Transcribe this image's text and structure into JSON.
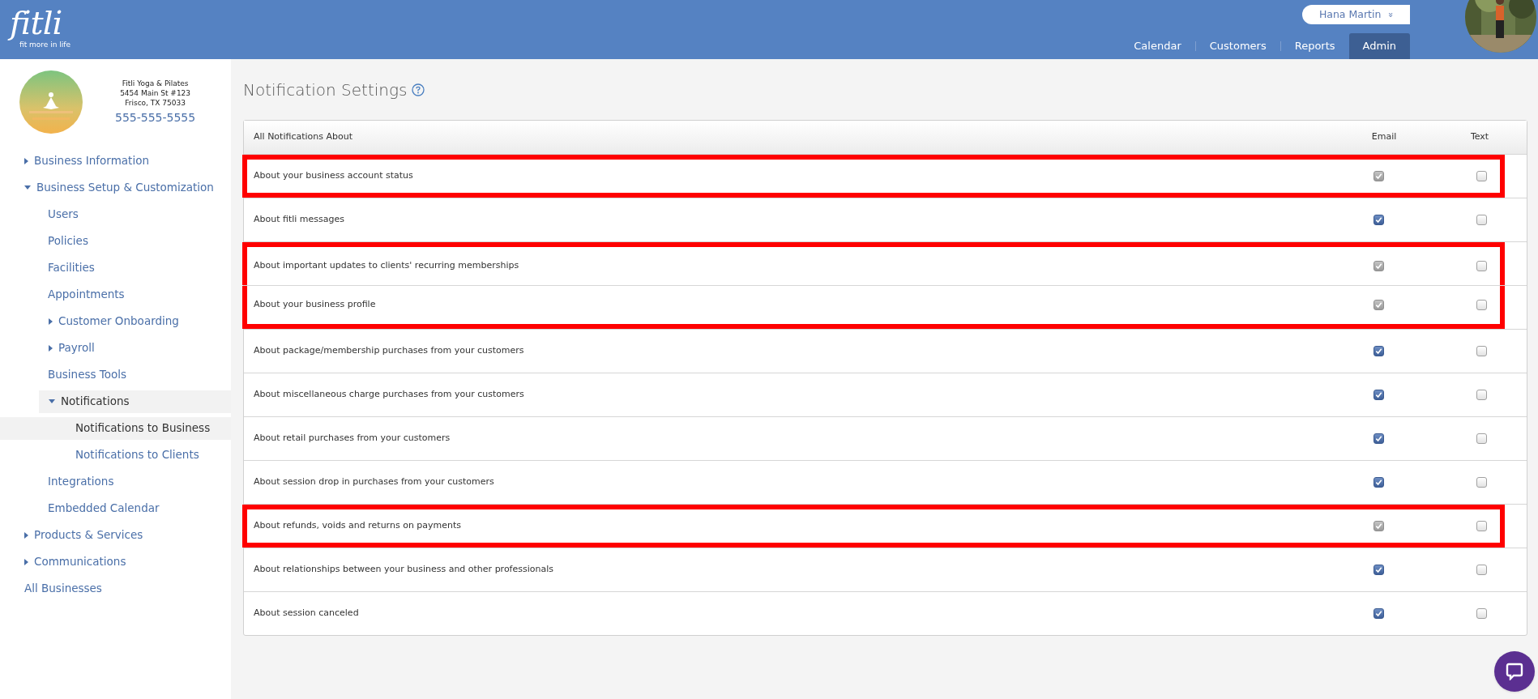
{
  "header": {
    "logo": {
      "word": "fitli",
      "tagline": "fit more in life"
    },
    "user": {
      "name": "Hana Martin",
      "menu_icon": "»"
    },
    "nav": [
      {
        "label": "Calendar",
        "selected": false
      },
      {
        "label": "Customers",
        "selected": false
      },
      {
        "label": "Reports",
        "selected": false
      },
      {
        "label": "Admin",
        "selected": true
      }
    ]
  },
  "business": {
    "name": "Fitli Yoga & Pilates",
    "address_line_1": "5454 Main St #123",
    "address_line_2": "Frisco, TX 75033",
    "phone": "555-555-5555"
  },
  "sidebar": {
    "items": [
      {
        "label": "Business Information",
        "expanded": false,
        "selected": false
      },
      {
        "label": "Business Setup & Customization",
        "expanded": true,
        "selected": false,
        "children": [
          {
            "label": "Users",
            "selected": false
          },
          {
            "label": "Policies",
            "selected": false
          },
          {
            "label": "Facilities",
            "selected": false
          },
          {
            "label": "Appointments",
            "selected": false
          },
          {
            "label": "Customer Onboarding",
            "expanded": false,
            "selected": false
          },
          {
            "label": "Payroll",
            "expanded": false,
            "selected": false
          },
          {
            "label": "Business Tools",
            "selected": false
          },
          {
            "label": "Notifications",
            "expanded": true,
            "selected": true,
            "children": [
              {
                "label": "Notifications to Business",
                "selected": true
              },
              {
                "label": "Notifications to Clients",
                "selected": false
              }
            ]
          },
          {
            "label": "Integrations",
            "selected": false
          },
          {
            "label": "Embedded Calendar",
            "selected": false
          }
        ]
      },
      {
        "label": "Products & Services",
        "expanded": false,
        "selected": false
      },
      {
        "label": "Communications",
        "expanded": false,
        "selected": false
      },
      {
        "label": "All Businesses",
        "selected": false
      }
    ]
  },
  "page_title": "Notification Settings",
  "table": {
    "columns": [
      "All Notifications About",
      "Email",
      "Text"
    ],
    "rows": [
      {
        "label": "About your business account status",
        "email_checked": true,
        "email_disabled": true,
        "text_checked": false,
        "highlighted": true
      },
      {
        "label": "About fitli messages",
        "email_checked": true,
        "email_disabled": false,
        "text_checked": false,
        "highlighted": false
      },
      {
        "label": "About important updates to clients' recurring memberships",
        "email_checked": true,
        "email_disabled": true,
        "text_checked": false,
        "highlighted": true
      },
      {
        "label": "About your business profile",
        "email_checked": true,
        "email_disabled": true,
        "text_checked": false,
        "highlighted": true
      },
      {
        "label": "About package/membership purchases from your customers",
        "email_checked": true,
        "email_disabled": false,
        "text_checked": false,
        "highlighted": false
      },
      {
        "label": "About miscellaneous charge purchases from your customers",
        "email_checked": true,
        "email_disabled": false,
        "text_checked": false,
        "highlighted": false
      },
      {
        "label": "About retail purchases from your customers",
        "email_checked": true,
        "email_disabled": false,
        "text_checked": false,
        "highlighted": false
      },
      {
        "label": "About session drop in purchases from your customers",
        "email_checked": true,
        "email_disabled": false,
        "text_checked": false,
        "highlighted": false
      },
      {
        "label": "About refunds, voids and returns on payments",
        "email_checked": true,
        "email_disabled": true,
        "text_checked": false,
        "highlighted": true
      },
      {
        "label": "About relationships between your business and other professionals",
        "email_checked": true,
        "email_disabled": false,
        "text_checked": false,
        "highlighted": false
      },
      {
        "label": "About session canceled",
        "email_checked": true,
        "email_disabled": false,
        "text_checked": false,
        "highlighted": false
      }
    ]
  }
}
